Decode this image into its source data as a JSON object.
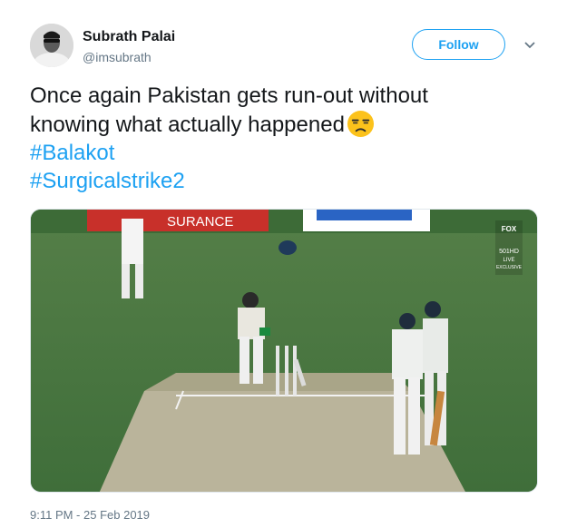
{
  "user": {
    "display_name": "Subrath Palai",
    "handle": "@imsubrath"
  },
  "follow_button": {
    "label": "Follow"
  },
  "tweet": {
    "text_line1": "Once again Pakistan gets run-out without",
    "text_line2": "knowing what actually happened",
    "emoji": "unamused-face",
    "hashtags": [
      "#Balakot",
      "#Surgicalstrike2"
    ],
    "timestamp": "9:11 PM - 25 Feb 2019"
  },
  "media": {
    "banner_text": "SURANCE",
    "channel_logo": "FOX 501 HD LIVE EXCLUSIVE",
    "colors": {
      "grass": "#4f7d45",
      "pitch": "#b7b29a",
      "accent": "#1da1f2"
    }
  }
}
